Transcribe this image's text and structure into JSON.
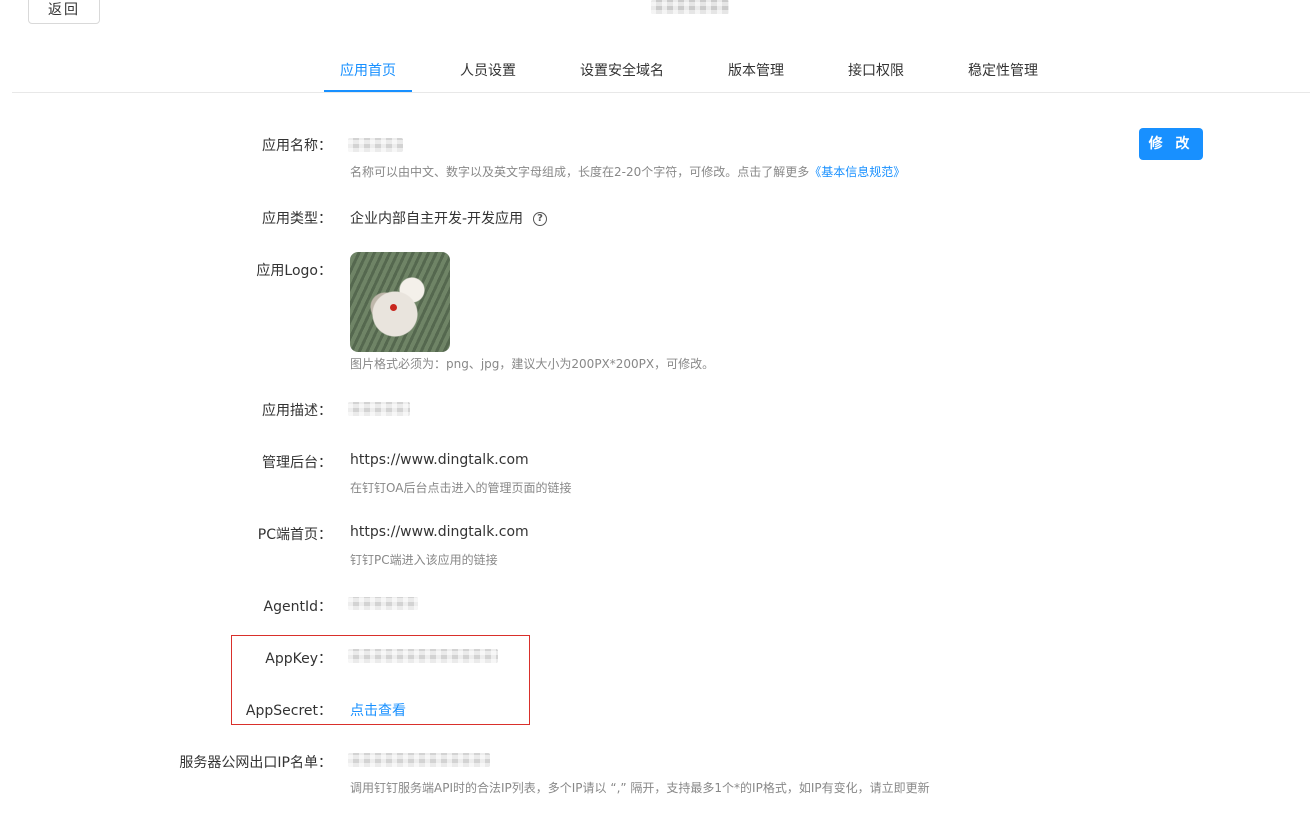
{
  "header": {
    "back_label": "返回"
  },
  "tabs": [
    {
      "label": "应用首页",
      "active": true
    },
    {
      "label": "人员设置",
      "active": false
    },
    {
      "label": "设置安全域名",
      "active": false
    },
    {
      "label": "版本管理",
      "active": false
    },
    {
      "label": "接口权限",
      "active": false
    },
    {
      "label": "稳定性管理",
      "active": false
    }
  ],
  "edit_label": "修 改",
  "fields": {
    "app_name": {
      "label": "应用名称：",
      "hint_text": "名称可以由中文、数字以及英文字母组成，长度在2-20个字符，可修改。点击了解更多",
      "hint_link": "《基本信息规范》"
    },
    "app_type": {
      "label": "应用类型：",
      "value": "企业内部自主开发-开发应用",
      "help_icon": "question-circle-icon"
    },
    "app_logo": {
      "label": "应用Logo：",
      "hint": "图片格式必须为：png、jpg，建议大小为200PX*200PX，可修改。"
    },
    "app_desc": {
      "label": "应用描述："
    },
    "admin_console": {
      "label": "管理后台：",
      "value": "https://www.dingtalk.com",
      "hint": "在钉钉OA后台点击进入的管理页面的链接"
    },
    "pc_home": {
      "label": "PC端首页：",
      "value": "https://www.dingtalk.com",
      "hint": "钉钉PC端进入该应用的链接"
    },
    "agent_id": {
      "label": "AgentId："
    },
    "app_key": {
      "label": "AppKey："
    },
    "app_secret": {
      "label": "AppSecret：",
      "link": "点击查看"
    },
    "server_ip": {
      "label": "服务器公网出口IP名单：",
      "hint": "调用钉钉服务端API时的合法IP列表，多个IP请以 “,” 隔开，支持最多1个*的IP格式，如IP有变化，请立即更新"
    }
  },
  "colors": {
    "accent": "#1890ff",
    "highlight_border": "#d9302b"
  }
}
